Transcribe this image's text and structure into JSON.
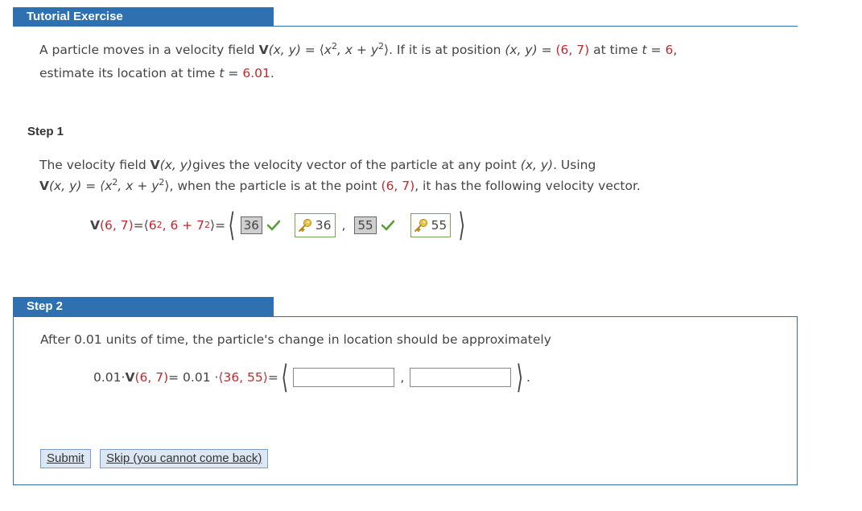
{
  "header": {
    "title": "Tutorial Exercise"
  },
  "problem": {
    "line1_a": "A particle moves in a velocity field ",
    "V": "V",
    "vars_xy": "(x, y)",
    "eq": " = ",
    "field_open": "⟨",
    "field_x": "x",
    "field_2": "2",
    "field_mid": ", x + y",
    "field_close": "⟩",
    "line1_b": ". If it is at position ",
    "pos_vars": "(x, y)",
    "pos_eq": " = ",
    "pos_val": "(6, 7)",
    "line1_c": " at time ",
    "t": "t",
    "t_eq": " = ",
    "t_val": "6",
    "comma": ",",
    "line2_a": "estimate its location at time ",
    "t2": "t",
    "t2_eq": " = ",
    "t2_val": "6.01",
    "period": "."
  },
  "step1": {
    "label": "Step 1",
    "p1_a": "The velocity field ",
    "p1_V": "V",
    "p1_vars": "(x, y)",
    "p1_b": "gives the velocity vector of the particle at any point ",
    "p1_pt": "(x, y)",
    "p1_c": ". Using",
    "p2_V": "V",
    "p2_vars": "(x, y)",
    "p2_eq": " = ",
    "p2_field_a": "⟨x",
    "p2_2a": "2",
    "p2_field_b": ", x + y",
    "p2_2b": "2",
    "p2_field_c": "⟩",
    "p2_b": ", when the particle is at the point ",
    "p2_pt": "(6, 7)",
    "p2_c": ", it has the following velocity vector.",
    "math_V": "V",
    "math_arg": "(6, 7)",
    "math_eq": " = ",
    "math_open": "⟨",
    "math_6": "6",
    "math_2a": "2",
    "math_mid": ", 6 + 7",
    "math_2b": "2",
    "math_close": "⟩",
    "math_eq2": " = ",
    "entry1": "36",
    "key1": "36",
    "comma": ",",
    "entry2": "55",
    "key2": "55",
    "open_angle": "⟨",
    "close_angle": "⟩"
  },
  "step2": {
    "label": "Step 2",
    "text": "After 0.01 units of time, the particle's change in location should be approximately",
    "m_coef": "0.01",
    "m_dot": " · ",
    "m_V": "V",
    "m_arg": "(6, 7)",
    "m_eq": " = 0.01 · ",
    "m_vec": "⟨36, 55⟩",
    "m_eq2": " = ",
    "open_angle": "⟨",
    "comma": ",",
    "close_angle": "⟩",
    "period": ".",
    "input1_value": "",
    "input2_value": ""
  },
  "buttons": {
    "submit": "Submit",
    "skip": "Skip (you cannot come back)"
  },
  "colors": {
    "accent": "#2f70b0",
    "highlight_red": "#c0282d",
    "check_green": "#5a9e3a"
  }
}
